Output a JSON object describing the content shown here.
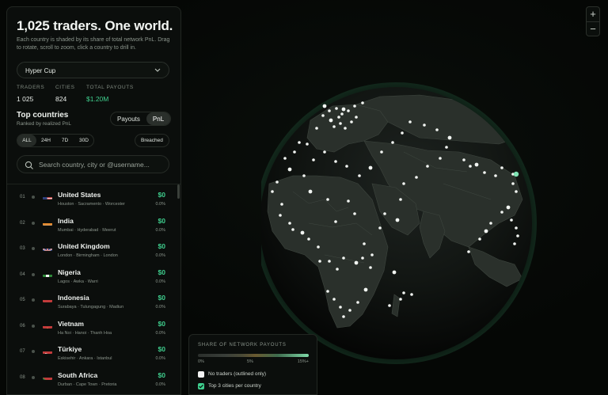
{
  "panel": {
    "title": "1,025 traders. One world.",
    "description": "Each country is shaded by its share of total network PnL. Drag to rotate, scroll to zoom, click a country to drill in.",
    "cup_select": "Hyper Cup",
    "stats": [
      {
        "label": "TRADERS",
        "value": "1 025"
      },
      {
        "label": "CITIES",
        "value": "824"
      },
      {
        "label": "TOTAL PAYOUTS",
        "value": "$1.20M"
      }
    ],
    "top_countries_title": "Top countries",
    "top_countries_sub": "Ranked by realized PnL",
    "metric_toggle": [
      "Payouts",
      "PnL"
    ],
    "metric_selected": "PnL",
    "time_filters": [
      "ALL",
      "24H",
      "7D",
      "30D"
    ],
    "time_selected": "ALL",
    "breached_label": "Breached",
    "search_placeholder": "Search country, city or @username...",
    "countries": [
      {
        "rank": "01",
        "flag": "us-flag",
        "name": "United States",
        "cities": "Houston · Sacramento · Worcester",
        "amount": "$0",
        "pct": "0.0%"
      },
      {
        "rank": "02",
        "flag": "in-flag",
        "name": "India",
        "cities": "Mumbai · Hyderabad · Meerut",
        "amount": "$0",
        "pct": "0.0%"
      },
      {
        "rank": "03",
        "flag": "gb-flag",
        "name": "United Kingdom",
        "cities": "London · Birmingham · London",
        "amount": "$0",
        "pct": "0.0%"
      },
      {
        "rank": "04",
        "flag": "ng-flag",
        "name": "Nigeria",
        "cities": "Lagos · Awka · Warri",
        "amount": "$0",
        "pct": "0.0%"
      },
      {
        "rank": "05",
        "flag": "id-flag",
        "name": "Indonesia",
        "cities": "Surabaya · Tulungagung · Madiun",
        "amount": "$0",
        "pct": "0.0%"
      },
      {
        "rank": "06",
        "flag": "vn-flag",
        "name": "Vietnam",
        "cities": "Ha Noi · Hanoi · Thanh Hoa",
        "amount": "$0",
        "pct": "0.0%"
      },
      {
        "rank": "07",
        "flag": "tr-flag",
        "name": "Türkiye",
        "cities": "Eskisehir · Ankara · Istanbul",
        "amount": "$0",
        "pct": "0.0%"
      },
      {
        "rank": "08",
        "flag": "za-flag",
        "name": "South Africa",
        "cities": "Durban · Cape Town · Pretoria",
        "amount": "$0",
        "pct": "0.0%"
      }
    ]
  },
  "legend": {
    "title": "SHARE OF NETWORK PAYOUTS",
    "ticks": [
      "0%",
      "5%",
      "15%+"
    ],
    "options": [
      {
        "label": "No traders (outlined only)",
        "checked": false
      },
      {
        "label": "Top 3 cities per country",
        "checked": true
      }
    ]
  },
  "zoom": {
    "in": "+",
    "out": "−"
  },
  "colors": {
    "accent": "#3fcf8e",
    "background": "#050705",
    "panel": "#0b0e0c"
  }
}
